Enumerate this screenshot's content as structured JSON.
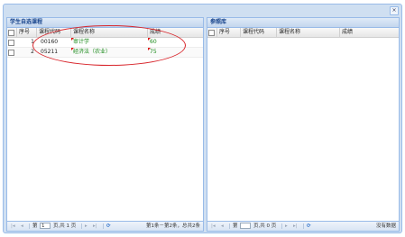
{
  "window": {
    "close_glyph": "×"
  },
  "left_panel": {
    "title": "学生自选课程",
    "columns": [
      "序号",
      "课程代码",
      "课程名称",
      "成绩"
    ],
    "rows": [
      {
        "index": "1",
        "code": "00160",
        "name": "审计学",
        "score": "60"
      },
      {
        "index": "2",
        "code": "05211",
        "name": "经济法（农业）",
        "score": "75"
      }
    ],
    "pager": {
      "first_icon": "first-page-icon",
      "prev_icon": "prev-page-icon",
      "page_prefix": "第",
      "page_value": "1",
      "page_suffix": "页,共 1 页",
      "next_icon": "next-page-icon",
      "last_icon": "last-page-icon",
      "refresh_icon": "refresh-icon",
      "info": "第1条－第2条，总共2条"
    }
  },
  "right_panel": {
    "title": "参照库",
    "columns": [
      "序号",
      "课程代码",
      "课程名称",
      "成绩"
    ],
    "pager": {
      "page_prefix": "第",
      "page_value": "",
      "page_suffix": "页,共 0 页",
      "info": "没有数据"
    }
  },
  "colors": {
    "panel_border": "#99bbe8",
    "title_text": "#15428b",
    "highlight_ellipse": "#d8242a",
    "value_text": "#1a8a1a"
  }
}
